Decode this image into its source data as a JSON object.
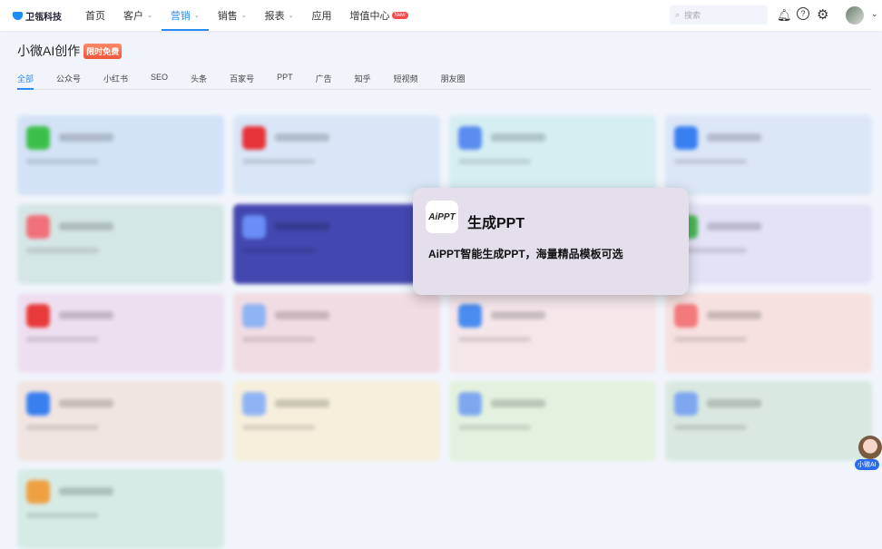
{
  "header": {
    "brand": "卫瓴科技",
    "nav": [
      {
        "label": "首页"
      },
      {
        "label": "客户",
        "chevron": true
      },
      {
        "label": "营销",
        "chevron": true,
        "active": true
      },
      {
        "label": "销售",
        "chevron": true
      },
      {
        "label": "报表",
        "chevron": true
      },
      {
        "label": "应用"
      },
      {
        "label": "增值中心",
        "badge": "New"
      }
    ],
    "search_placeholder": "搜索",
    "icons": [
      "bell-icon",
      "help-icon",
      "gear-icon"
    ]
  },
  "page": {
    "title": "小微AI创作",
    "badge": "限时免费"
  },
  "tabs": [
    "全部",
    "公众号",
    "小红书",
    "SEO",
    "头条",
    "百家号",
    "PPT",
    "广告",
    "知乎",
    "短视频",
    "朋友圈"
  ],
  "active_tab": 0,
  "cards": [
    {
      "bg": "#d3e2f7",
      "icon": "#3bbf4a"
    },
    {
      "bg": "#d8e6f7",
      "icon": "#e8333a"
    },
    {
      "bg": "#d5eef2",
      "icon": "#5b8cf0"
    },
    {
      "bg": "#dbe6f7",
      "icon": "#3a7ff0"
    },
    {
      "bg": "#d5e6e6",
      "icon": "#f2707a"
    },
    {
      "bg": "#4347b0",
      "icon": "#6a8df7"
    },
    {
      "bg": "#d5eef2",
      "icon": "#5b8cf0"
    },
    {
      "bg": "#e4e2f7",
      "icon": "#4cb85a"
    },
    {
      "bg": "#eedff0",
      "icon": "#e83a3a"
    },
    {
      "bg": "#f1dce3",
      "icon": "#8fb4f5"
    },
    {
      "bg": "#f5e6ea",
      "icon": "#4a8cf0"
    },
    {
      "bg": "#f6e1e0",
      "icon": "#f27a7a"
    },
    {
      "bg": "#f1e5e1",
      "icon": "#3a7ff0"
    },
    {
      "bg": "#f6efdc",
      "icon": "#8fb4f5"
    },
    {
      "bg": "#e3f2df",
      "icon": "#7ea7f0"
    },
    {
      "bg": "#d9e8e0",
      "icon": "#7ea7f0"
    },
    {
      "bg": "#d6ebe6",
      "icon": "#f0a040"
    }
  ],
  "popup": {
    "logo": "AiPPT",
    "title": "生成PPT",
    "desc": "AiPPT智能生成PPT，海量精品模板可选"
  },
  "helper": {
    "label": "小微AI"
  }
}
